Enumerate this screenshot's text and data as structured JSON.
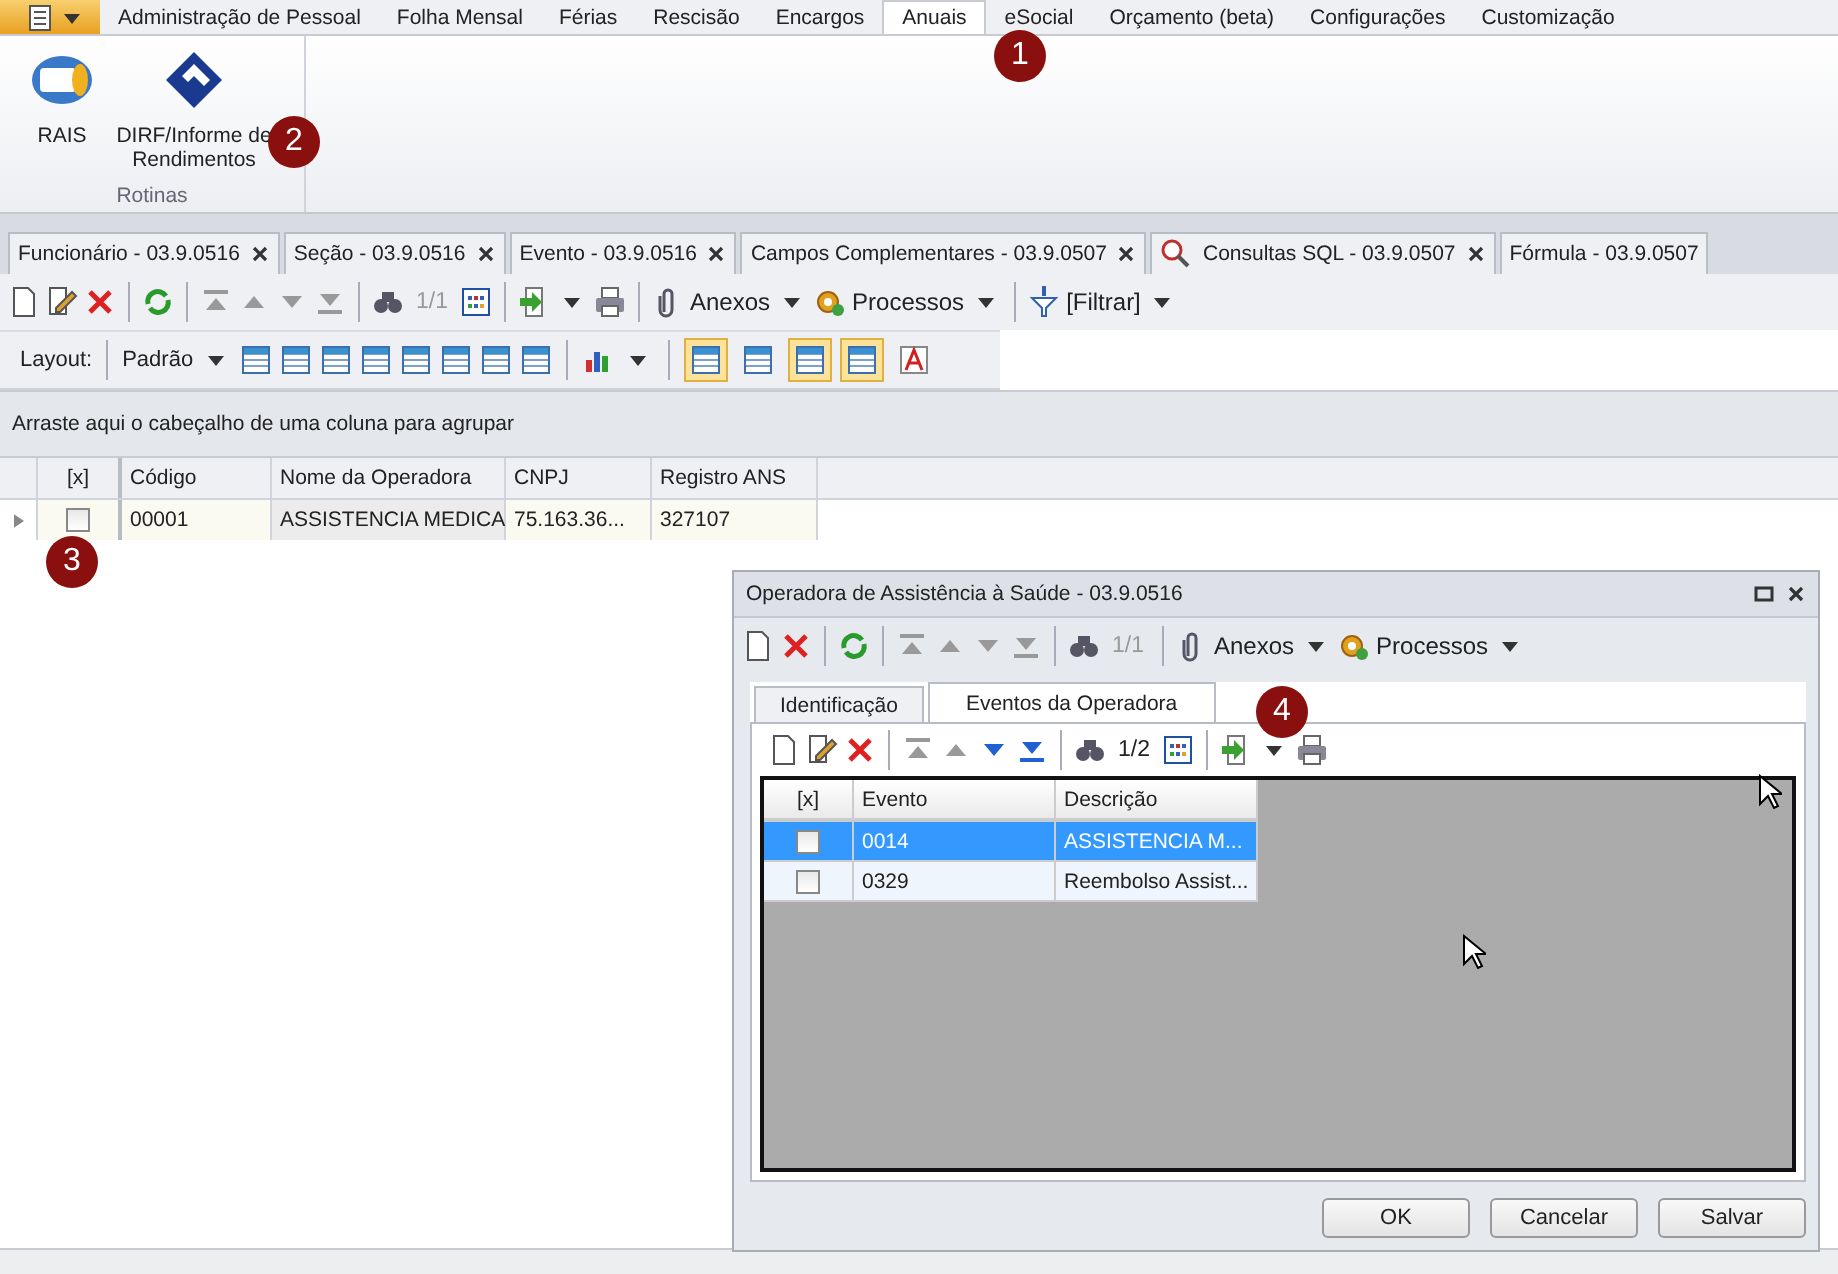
{
  "ribbon": {
    "tabs": [
      {
        "label": "Administração de Pessoal",
        "selected": false
      },
      {
        "label": "Folha Mensal",
        "selected": false
      },
      {
        "label": "Férias",
        "selected": false
      },
      {
        "label": "Rescisão",
        "selected": false
      },
      {
        "label": "Encargos",
        "selected": false
      },
      {
        "label": "Anuais",
        "selected": true
      },
      {
        "label": "eSocial",
        "selected": false
      },
      {
        "label": "Orçamento (beta)",
        "selected": false
      },
      {
        "label": "Configurações",
        "selected": false
      },
      {
        "label": "Customização",
        "selected": false
      }
    ],
    "group": {
      "label": "Rotinas",
      "buttons": [
        "RAIS",
        "DIRF/Informe de Rendimentos"
      ]
    }
  },
  "annotations": [
    "1",
    "2",
    "3",
    "4"
  ],
  "document_tabs": [
    {
      "label": "Funcionário - 03.9.0516",
      "closable": true
    },
    {
      "label": "Seção - 03.9.0516",
      "closable": true
    },
    {
      "label": "Evento - 03.9.0516",
      "closable": true
    },
    {
      "label": "Campos Complementares - 03.9.0507",
      "closable": true
    },
    {
      "label": "Consultas SQL - 03.9.0507",
      "closable": true
    },
    {
      "label": "Fórmula - 03.9.0507",
      "closable": false
    }
  ],
  "toolbar": {
    "counter": "1/1",
    "counter_disabled": true,
    "attachments": "Anexos",
    "processes": "Processos",
    "filter": "[Filtrar]"
  },
  "layout_bar": {
    "label": "Layout:",
    "preset": "Padrão",
    "toggles": [
      {
        "on": true
      },
      {
        "on": false
      },
      {
        "on": true
      },
      {
        "on": true
      },
      {
        "on": false
      }
    ]
  },
  "group_panel": "Arraste aqui o cabeçalho de uma coluna para agrupar",
  "grid": {
    "columns": [
      "[x]",
      "Código",
      "Nome da Operadora",
      "CNPJ",
      "Registro ANS"
    ],
    "rows": [
      {
        "checked": false,
        "cells": [
          "",
          "00001",
          "ASSISTENCIA MEDICA",
          "75.163.36...",
          "327107"
        ]
      }
    ]
  },
  "dialog": {
    "title": "Operadora de Assistência à Saúde - 03.9.0516",
    "toolbar": {
      "counter": "1/1",
      "counter_disabled": true,
      "attachments": "Anexos",
      "processes": "Processos"
    },
    "tabs": [
      {
        "label": "Identificação",
        "selected": false
      },
      {
        "label": "Eventos da Operadora",
        "selected": true
      }
    ],
    "inner_toolbar": {
      "counter": "1/2",
      "counter_disabled": false
    },
    "grid": {
      "columns": [
        "[x]",
        "Evento",
        "Descrição"
      ],
      "rows": [
        {
          "selected": true,
          "checked": false,
          "cells": [
            "",
            "0014",
            "ASSISTENCIA M..."
          ]
        },
        {
          "selected": false,
          "checked": false,
          "cells": [
            "",
            "0329",
            "Reembolso Assist..."
          ]
        }
      ]
    },
    "buttons": [
      "OK",
      "Cancelar",
      "Salvar"
    ]
  }
}
